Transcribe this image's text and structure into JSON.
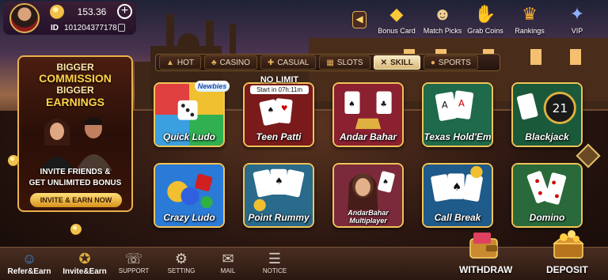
{
  "player": {
    "balance": "153.36",
    "add_label": "+",
    "id_label": "ID",
    "id_value": "101204377178"
  },
  "top_icons": [
    {
      "label": "Bonus Card",
      "icon": "treasure-coins-icon"
    },
    {
      "label": "Match Picks",
      "icon": "match-picks-icon"
    },
    {
      "label": "Grab Coins",
      "icon": "grab-coins-icon"
    },
    {
      "label": "Rankings",
      "icon": "rankings-icon"
    },
    {
      "label": "VIP",
      "icon": "vip-badge-icon"
    }
  ],
  "tabs": [
    {
      "label": "HOT",
      "icon": "flame-icon",
      "active": false
    },
    {
      "label": "CASINO",
      "icon": "casino-icon",
      "active": false
    },
    {
      "label": "CASUAL",
      "icon": "gamepad-icon",
      "active": false
    },
    {
      "label": "SLOTS",
      "icon": "slots-icon",
      "active": false
    },
    {
      "label": "SKILL",
      "icon": "skill-icon",
      "active": true
    },
    {
      "label": "SPORTS",
      "icon": "ball-icon",
      "active": false
    }
  ],
  "promo": {
    "line1": "BIGGER",
    "line2": "COMMISSION",
    "line3": "BIGGER",
    "line4": "EARNINGS",
    "invite_line1": "INVITE FRIENDS &",
    "invite_line2": "GET UNLIMITED BONUS",
    "cta": "INVITE & EARN NOW"
  },
  "games": [
    {
      "name": "Quick Ludo"
    },
    {
      "name": "Teen Patti"
    },
    {
      "name": "Andar Bahar"
    },
    {
      "name": "Texas Hold'Em"
    },
    {
      "name": "Blackjack"
    },
    {
      "name": "Crazy Ludo"
    },
    {
      "name": "Point Rummy"
    },
    {
      "name": "AndarBahar Multiplayer"
    },
    {
      "name": "Call Break"
    },
    {
      "name": "Domino"
    }
  ],
  "badges": {
    "newbies": "Newbies",
    "no_limit": "NO LIMIT",
    "timer": "Start in 07h:11m"
  },
  "bottom_nav": [
    {
      "label": "Refer&Earn",
      "icon": "refer-earn-icon"
    },
    {
      "label": "Invite&Earn",
      "icon": "invite-earn-icon"
    },
    {
      "label": "SUPPORT",
      "icon": "support-chat-icon"
    },
    {
      "label": "SETTING",
      "icon": "gear-icon"
    },
    {
      "label": "MAIL",
      "icon": "mail-icon"
    },
    {
      "label": "NOTICE",
      "icon": "notice-icon"
    }
  ],
  "actions": {
    "withdraw": "WITHDRAW",
    "deposit": "DEPOSIT"
  },
  "colors": {
    "gold": "#f0c458",
    "active_tab": "#f6e8c6"
  }
}
